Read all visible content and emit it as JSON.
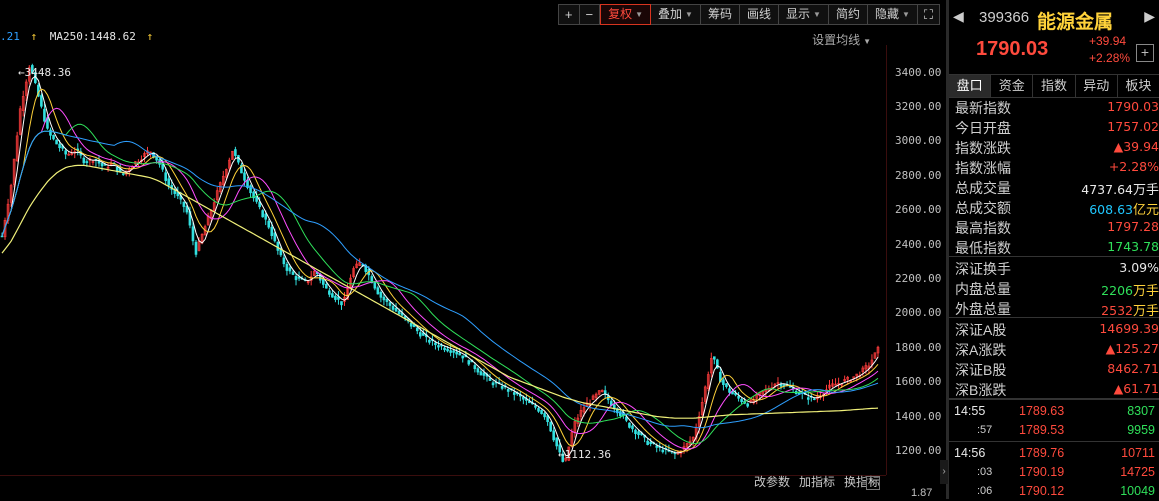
{
  "toolbar": {
    "items": [
      {
        "label": "+",
        "name": "zoom-in-button"
      },
      {
        "label": "−",
        "name": "zoom-out-button"
      },
      {
        "label": "复权",
        "name": "restore-rights-dropdown",
        "caret": true,
        "active": true
      },
      {
        "label": "叠加",
        "name": "overlay-dropdown",
        "caret": true
      },
      {
        "label": "筹码",
        "name": "chips-button"
      },
      {
        "label": "画线",
        "name": "draw-line-button"
      },
      {
        "label": "显示",
        "name": "display-dropdown",
        "caret": true
      },
      {
        "label": "简约",
        "name": "simple-mode-button"
      },
      {
        "label": "隐藏",
        "name": "hide-dropdown",
        "caret": true
      },
      {
        "label": "⛶",
        "name": "fullscreen-button"
      }
    ]
  },
  "ma_bar": {
    "ma_prev_value": ".21",
    "ma250_label": "MA250:1448.62",
    "arrow": "↑",
    "settings_label": "设置均线"
  },
  "chart_data": {
    "type": "line",
    "title": "",
    "y_ticks": [
      "3400.00",
      "3200.00",
      "3000.00",
      "2800.00",
      "2600.00",
      "2400.00",
      "2200.00",
      "2000.00",
      "1800.00",
      "1600.00",
      "1400.00",
      "1200.00"
    ],
    "ylim": [
      1060,
      3560
    ],
    "high_label": "3448.36",
    "low_label": "1112.36",
    "volume_axis_label": "1.87",
    "colors": {
      "candle_up": "#ff3c3c",
      "candle_down": "#33e0e0",
      "ma5": "#ffffff",
      "ma10": "#ffd23a",
      "ma20": "#ff4dff",
      "ma30": "#2fe05a",
      "ma60": "#2e9fff",
      "ma250": "#f0f07a"
    },
    "series": [
      {
        "name": "close",
        "values": [
          2450,
          2750,
          3200,
          3448,
          3250,
          3050,
          2980,
          2920,
          2950,
          2880,
          2900,
          2850,
          2870,
          2800,
          2860,
          2900,
          2950,
          2880,
          2750,
          2680,
          2600,
          2350,
          2500,
          2650,
          2800,
          2950,
          2820,
          2700,
          2600,
          2500,
          2350,
          2250,
          2200,
          2180,
          2250,
          2150,
          2100,
          2050,
          2250,
          2300,
          2200,
          2100,
          2050,
          2000,
          1950,
          1900,
          1850,
          1820,
          1800,
          1780,
          1750,
          1700,
          1650,
          1600,
          1580,
          1550,
          1520,
          1480,
          1450,
          1400,
          1250,
          1112,
          1350,
          1450,
          1500,
          1550,
          1480,
          1420,
          1350,
          1300,
          1250,
          1220,
          1200,
          1180,
          1220,
          1280,
          1500,
          1760,
          1600,
          1540,
          1500,
          1470,
          1520,
          1560,
          1600,
          1580,
          1550,
          1520,
          1500,
          1540,
          1580,
          1600,
          1620,
          1650,
          1700,
          1790
        ]
      },
      {
        "name": "MA250",
        "values": [
          2350,
          2420,
          2520,
          2620,
          2700,
          2770,
          2820,
          2850,
          2860,
          2860,
          2850,
          2840,
          2830,
          2820,
          2810,
          2800,
          2790,
          2770,
          2740,
          2710,
          2680,
          2650,
          2620,
          2590,
          2560,
          2530,
          2500,
          2470,
          2440,
          2410,
          2380,
          2350,
          2320,
          2290,
          2260,
          2230,
          2200,
          2170,
          2140,
          2110,
          2080,
          2050,
          2020,
          1990,
          1960,
          1930,
          1900,
          1870,
          1840,
          1810,
          1780,
          1750,
          1720,
          1690,
          1660,
          1630,
          1610,
          1590,
          1570,
          1550,
          1530,
          1510,
          1495,
          1480,
          1470,
          1460,
          1450,
          1440,
          1430,
          1420,
          1410,
          1400,
          1395,
          1390,
          1390,
          1390,
          1395,
          1400,
          1405,
          1410,
          1412,
          1414,
          1416,
          1418,
          1420,
          1422,
          1424,
          1426,
          1428,
          1430,
          1432,
          1434,
          1438,
          1442,
          1446,
          1449
        ]
      }
    ]
  },
  "bottom_tools": {
    "items": [
      "改参数",
      "加指标",
      "换指标"
    ],
    "close": "×"
  },
  "panel": {
    "back_arrow": "◀",
    "fwd_arrow": "▶",
    "code": "399366",
    "name": "能源金属",
    "price": "1790.03",
    "change_abs": "+39.94",
    "change_pct": "+2.28%",
    "add_label": "+",
    "tabs": [
      "盘口",
      "资金",
      "指数",
      "异动",
      "板块"
    ],
    "quotes_a": [
      {
        "label": "最新指数",
        "value": "1790.03",
        "color": "red"
      },
      {
        "label": "今日开盘",
        "value": "1757.02",
        "color": "red"
      },
      {
        "label": "指数涨跌",
        "value": "▲39.94",
        "color": "red"
      },
      {
        "label": "指数涨幅",
        "value": "+2.28%",
        "color": "red"
      },
      {
        "label": "总成交量",
        "value": "4737.64",
        "unit": "万手",
        "color": "white",
        "unit_color": "white"
      },
      {
        "label": "总成交额",
        "value": "608.63",
        "unit": "亿元",
        "color": "cyan",
        "unit_color": "yellow"
      },
      {
        "label": "最高指数",
        "value": "1797.28",
        "color": "red"
      },
      {
        "label": "最低指数",
        "value": "1743.78",
        "color": "green"
      }
    ],
    "quotes_b": [
      {
        "label": "深证换手",
        "value": "3.09%",
        "color": "white"
      },
      {
        "label": "内盘总量",
        "value": "2206",
        "unit": "万手",
        "color": "green",
        "unit_color": "yellow"
      },
      {
        "label": "外盘总量",
        "value": "2532",
        "unit": "万手",
        "color": "red",
        "unit_color": "yellow"
      }
    ],
    "quotes_c": [
      {
        "label": "深证A股",
        "value": "14699.39",
        "color": "red"
      },
      {
        "label": "深A涨跌",
        "value": "▲125.27",
        "color": "red"
      },
      {
        "label": "深证B股",
        "value": "8462.71",
        "color": "red"
      },
      {
        "label": "深B涨跌",
        "value": "▲61.71",
        "color": "red"
      }
    ],
    "ticks": [
      {
        "time": "14:55",
        "small": false,
        "price": "1789.63",
        "vol": "8307",
        "vol_color": "green"
      },
      {
        "time": ":57",
        "small": true,
        "price": "1789.53",
        "vol": "9959",
        "vol_color": "green"
      },
      {
        "time": "14:56",
        "small": false,
        "price": "1789.76",
        "vol": "10711",
        "vol_color": "red"
      },
      {
        "time": ":03",
        "small": true,
        "price": "1790.19",
        "vol": "14725",
        "vol_color": "red"
      },
      {
        "time": ":06",
        "small": true,
        "price": "1790.12",
        "vol": "10049",
        "vol_color": "green"
      }
    ]
  }
}
